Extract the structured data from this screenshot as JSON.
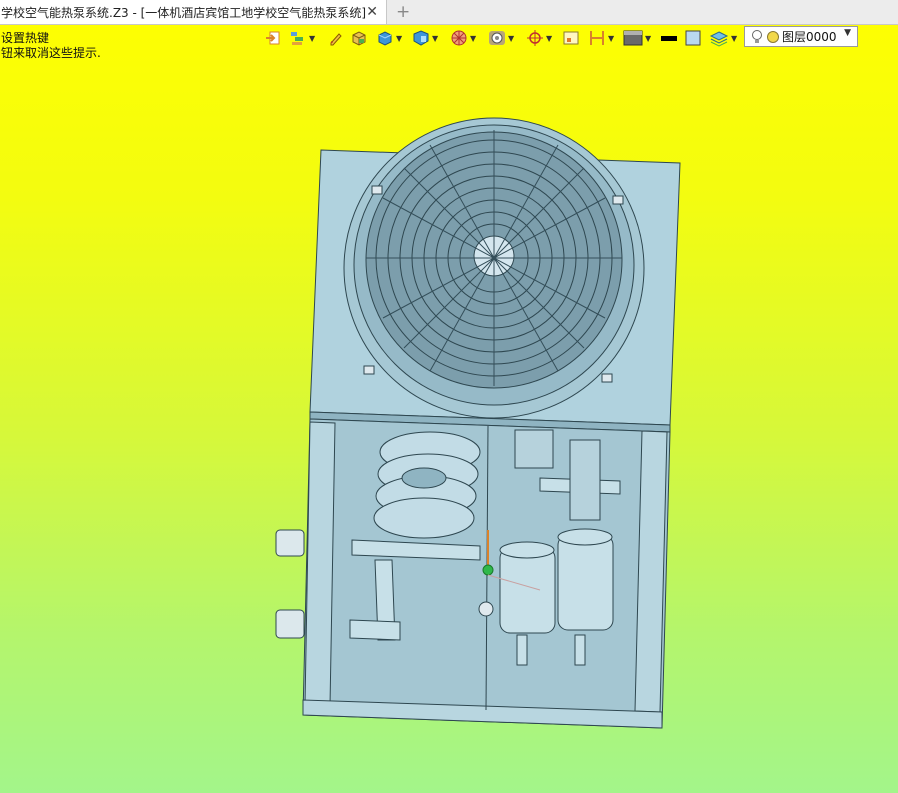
{
  "tab": {
    "title": "学校空气能热泵系统.Z3 - [一体机酒店宾馆工地学校空气能热泵系统]",
    "close_glyph": "✕",
    "new_glyph": "+"
  },
  "hints": {
    "line1": "设置热键",
    "line2": "钮来取消这些提示."
  },
  "toolbar": {
    "icons": [
      "exit-to-part-icon",
      "layer-manager-icon",
      "edit-pen-icon",
      "shaded-box-icon",
      "solid-view-icon",
      "display-mode-icon",
      "view-wheel-icon",
      "render-mode-icon",
      "target-point-icon",
      "datum-plane-icon",
      "dimension-icon",
      "background-icon",
      "line-color-icon",
      "fill-color-icon",
      "layers-icon"
    ],
    "layer_value": "图层0000"
  },
  "colors": {
    "background_top": "#ffff00",
    "background_bottom": "#a3f58a",
    "model_fill": "#a9ccd8",
    "model_line": "#2e4750"
  }
}
